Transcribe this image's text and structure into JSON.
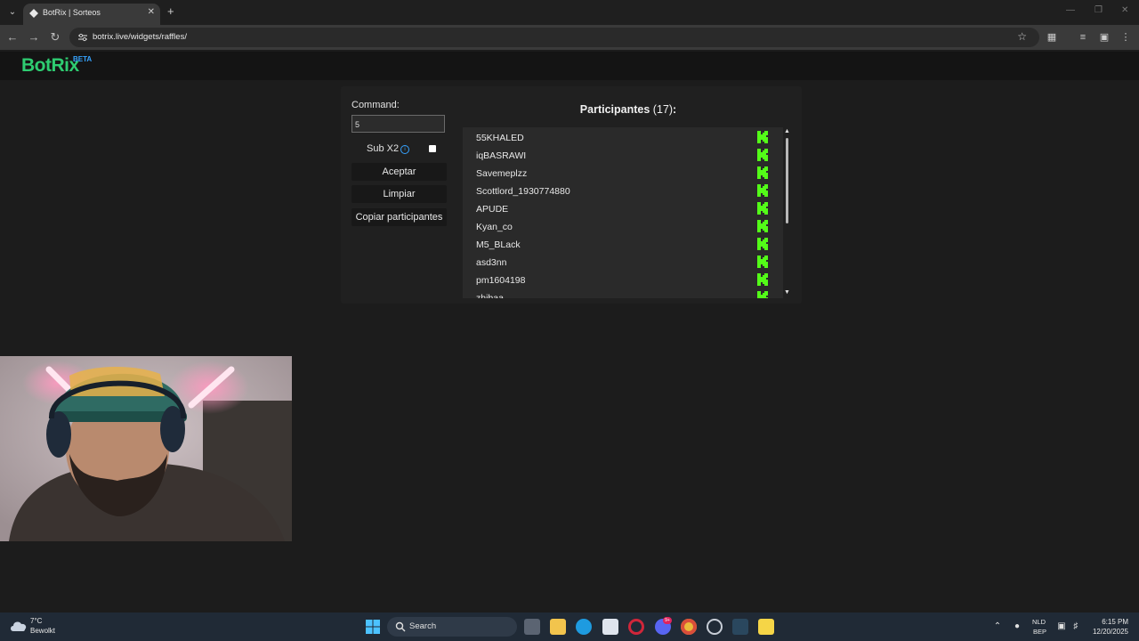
{
  "browser": {
    "tab_title": "BotRix | Sorteos",
    "url": "botrix.live/widgets/raffles/"
  },
  "header": {
    "logo_text": "BotRix",
    "beta_label": "BETA"
  },
  "raffle": {
    "command_label": "Command:",
    "command_value": "5",
    "sub_label": "Sub X2",
    "sub_checked": false,
    "buttons": {
      "accept": "Aceptar",
      "clear": "Limpiar",
      "copy": "Copiar participantes"
    },
    "participants_title": "Participantes",
    "participants_count": "(17)",
    "participants_colon": ":",
    "participants": [
      "55KHALED",
      "iqBASRAWI",
      "Savemeplzz",
      "Scottlord_1930774880",
      "APUDE",
      "Kyan_co",
      "M5_BLack",
      "asd3nn",
      "pm1604198",
      "zhibaa"
    ],
    "platform_icon": "kick-icon"
  },
  "taskbar": {
    "temperature": "7°C",
    "condition": "Bewolkt",
    "search_placeholder": "Search",
    "discord_badge": "9+",
    "lang_top": "NLD",
    "lang_bottom": "BEP",
    "time": "6:15 PM",
    "date": "12/20/2025"
  },
  "colors": {
    "brand_green": "#2ecc71",
    "kick_green": "#53fc18",
    "beta_blue": "#36a3ff"
  }
}
